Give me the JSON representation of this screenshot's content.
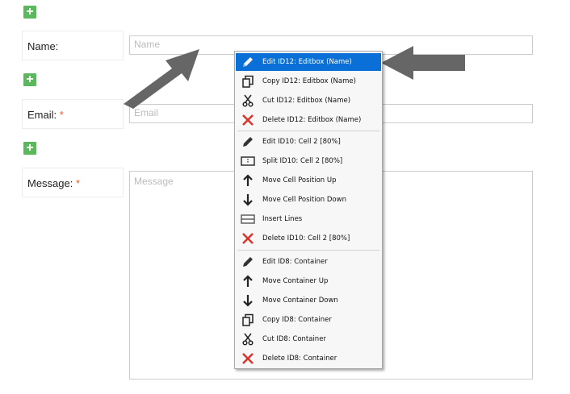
{
  "form": {
    "name": {
      "label": "Name:",
      "placeholder": "Name"
    },
    "email": {
      "label": "Email:",
      "required_mark": "*",
      "placeholder": "Email"
    },
    "message": {
      "label": "Message:",
      "required_mark": "*",
      "placeholder": "Message"
    },
    "add_button_label": "+"
  },
  "context_menu": {
    "groups": [
      [
        {
          "label": "Edit ID12: Editbox (Name)",
          "icon": "pencil-icon",
          "selected": true
        },
        {
          "label": "Copy ID12: Editbox (Name)",
          "icon": "copy-icon"
        },
        {
          "label": "Cut ID12: Editbox (Name)",
          "icon": "scissors-icon"
        },
        {
          "label": "Delete ID12: Editbox (Name)",
          "icon": "delete-x-icon"
        }
      ],
      [
        {
          "label": "Edit ID10: Cell 2 [80%]",
          "icon": "pencil-icon"
        },
        {
          "label": "Split ID10: Cell 2 [80%]",
          "icon": "split-icon"
        },
        {
          "label": "Move Cell Position Up",
          "icon": "arrow-up-icon"
        },
        {
          "label": "Move Cell Position Down",
          "icon": "arrow-down-icon"
        },
        {
          "label": "Insert Lines",
          "icon": "insert-lines-icon"
        },
        {
          "label": "Delete ID10: Cell 2 [80%]",
          "icon": "delete-x-icon"
        }
      ],
      [
        {
          "label": "Edit ID8: Container",
          "icon": "pencil-icon"
        },
        {
          "label": "Move Container Up",
          "icon": "arrow-up-icon"
        },
        {
          "label": "Move Container Down",
          "icon": "arrow-down-icon"
        },
        {
          "label": "Copy ID8: Container",
          "icon": "copy-icon"
        },
        {
          "label": "Cut ID8: Container",
          "icon": "scissors-icon"
        },
        {
          "label": "Delete ID8: Container",
          "icon": "delete-x-icon"
        }
      ]
    ]
  },
  "colors": {
    "add_button": "#5cb85c",
    "required_asterisk": "#e8602c",
    "menu_selected": "#0a6fd6",
    "delete_icon": "#d9342b",
    "annotation_arrow": "#666666"
  }
}
